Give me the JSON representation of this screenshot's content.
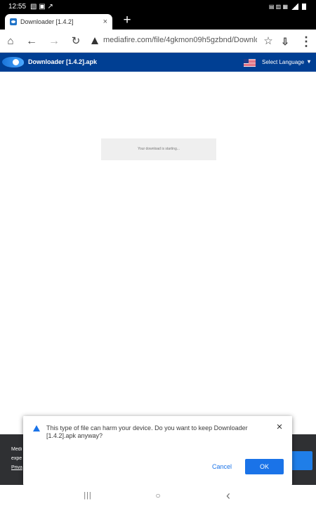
{
  "status_bar": {
    "time": "12:55",
    "left_indicators": "▧ ▣ ↗",
    "right_indicators": "▤ ▥ ▦"
  },
  "browser": {
    "tab": {
      "title": "Downloader [1.4.2]",
      "close": "×"
    },
    "new_tab": "+",
    "toolbar": {
      "home_icon": "home-icon",
      "back_icon": "back-arrow-icon",
      "forward_icon": "forward-arrow-icon",
      "reload_icon": "reload-icon",
      "url": "mediafire.com/file/4gkmon09h5gzbnd/Downloa",
      "star_icon": "star-icon",
      "download_icon": "download-icon",
      "menu_icon": "more-vert-icon"
    }
  },
  "mediafire": {
    "file_title": "Downloader [1.4.2].apk",
    "language_label": "Select Language",
    "chevron": "▾",
    "download_status": "Your download is starting..."
  },
  "footer": {
    "line_1": "Medi",
    "line_2": "expe",
    "link": "Priva"
  },
  "download_warning": {
    "message": "This type of file can harm your device. Do you want to keep Downloader [1.4.2].apk anyway?",
    "close": "×",
    "cancel": "Cancel",
    "ok": "OK"
  },
  "nav": {
    "recent": "|||",
    "home": "○",
    "back": "‹"
  },
  "colors": {
    "mediafire_blue": "#003f93",
    "chrome_blue": "#1a73e8",
    "status_bar_black": "#000000"
  }
}
